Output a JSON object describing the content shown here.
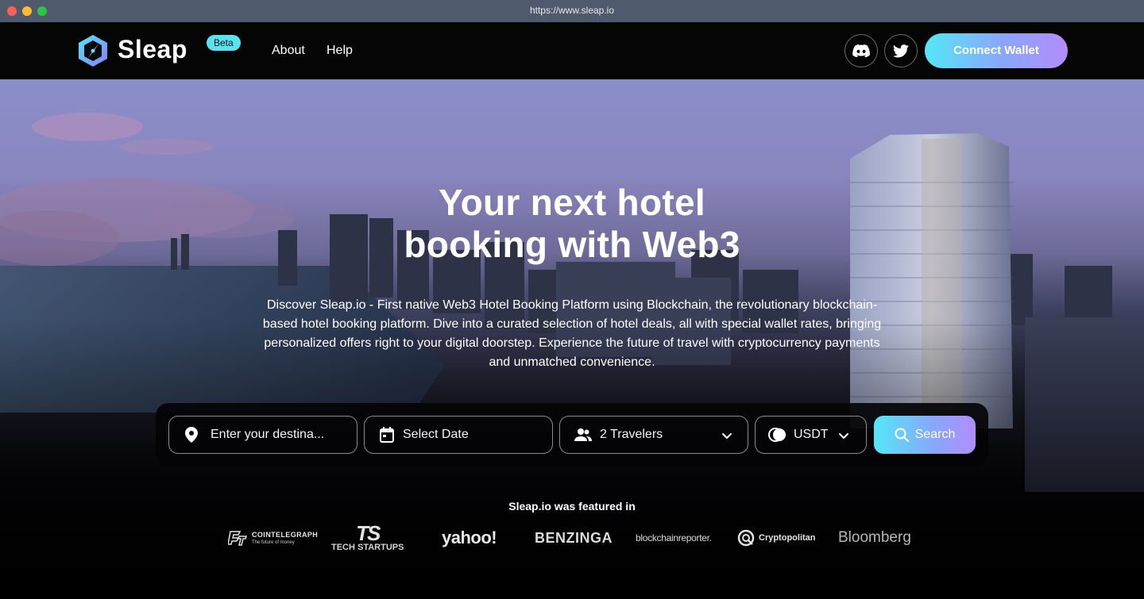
{
  "browser": {
    "url": "https://www.sleap.io"
  },
  "nav": {
    "brand": "Sleap",
    "badge": "Beta",
    "links": [
      "About",
      "Help"
    ],
    "connect_label": "Connect Wallet"
  },
  "hero": {
    "headline_line1": "Your next hotel",
    "headline_line2": "booking with Web3",
    "description": "Discover Sleap.io - First native Web3 Hotel Booking Platform using Blockchain, the revolutionary blockchain-based hotel booking platform. Dive into a curated selection of hotel deals, all with special wallet rates, bringing personalized offers right to your digital doorstep. Experience the future of travel with cryptocurrency payments and unmatched convenience."
  },
  "search": {
    "destination_placeholder": "Enter your destina...",
    "date_label": "Select Date",
    "travelers_value": "2 Travelers",
    "currency_value": "USDT",
    "search_label": "Search"
  },
  "featured": {
    "title": "Sleap.io was featured in",
    "logos": {
      "cointelegraph": "COINTELEGRAPH",
      "cointelegraph_tagline": "The future of money",
      "techstartups_mark": "TS",
      "techstartups": "TECH STARTUPS",
      "yahoo": "yahoo!",
      "benzinga": "BENZINGA",
      "blockchainreporter": "blockchainreporter.",
      "cryptopolitan": "Cryptopolitan",
      "bloomberg": "Bloomberg"
    }
  },
  "colors": {
    "accent_cyan": "#55e7f7",
    "accent_violet": "#b38cfb",
    "background": "#050505",
    "beta_badge": "#5ce1f0"
  },
  "icons": [
    "sleap-logo-icon",
    "discord-icon",
    "twitter-icon",
    "location-pin-icon",
    "calendar-icon",
    "users-icon",
    "chevron-down-icon",
    "currency-toggle-icon",
    "search-icon"
  ]
}
